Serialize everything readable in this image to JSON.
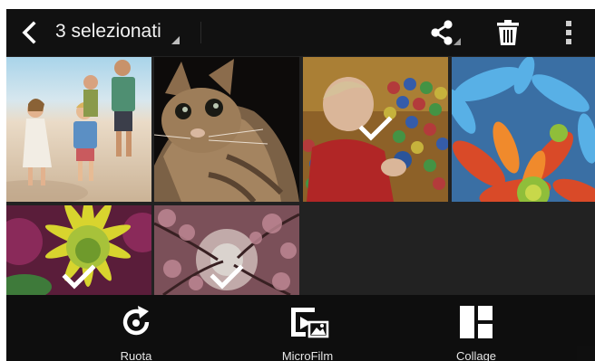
{
  "header": {
    "selection_title": "3 selezionati"
  },
  "icons": {
    "back": "chevron-left-icon",
    "share": "share-icon",
    "delete": "trash-icon",
    "more": "more-vertical-icon",
    "selected_mark": "check-icon"
  },
  "gallery": {
    "items": [
      {
        "subject": "family-on-beach",
        "selected": false
      },
      {
        "subject": "kitten",
        "selected": false
      },
      {
        "subject": "child-in-ball-pit",
        "selected": true
      },
      {
        "subject": "colorful-flowers",
        "selected": false
      },
      {
        "subject": "yellow-flower",
        "selected": true
      },
      {
        "subject": "blossom-tree",
        "selected": true
      }
    ]
  },
  "actions": [
    {
      "label": "Ruota",
      "icon": "rotate-icon"
    },
    {
      "label": "MicroFilm",
      "icon": "microfilm-icon"
    },
    {
      "label": "Collage",
      "icon": "collage-icon"
    }
  ],
  "colors": {
    "bar_background": "#111111",
    "grid_background": "#222222",
    "icon_foreground": "#ffffff"
  }
}
